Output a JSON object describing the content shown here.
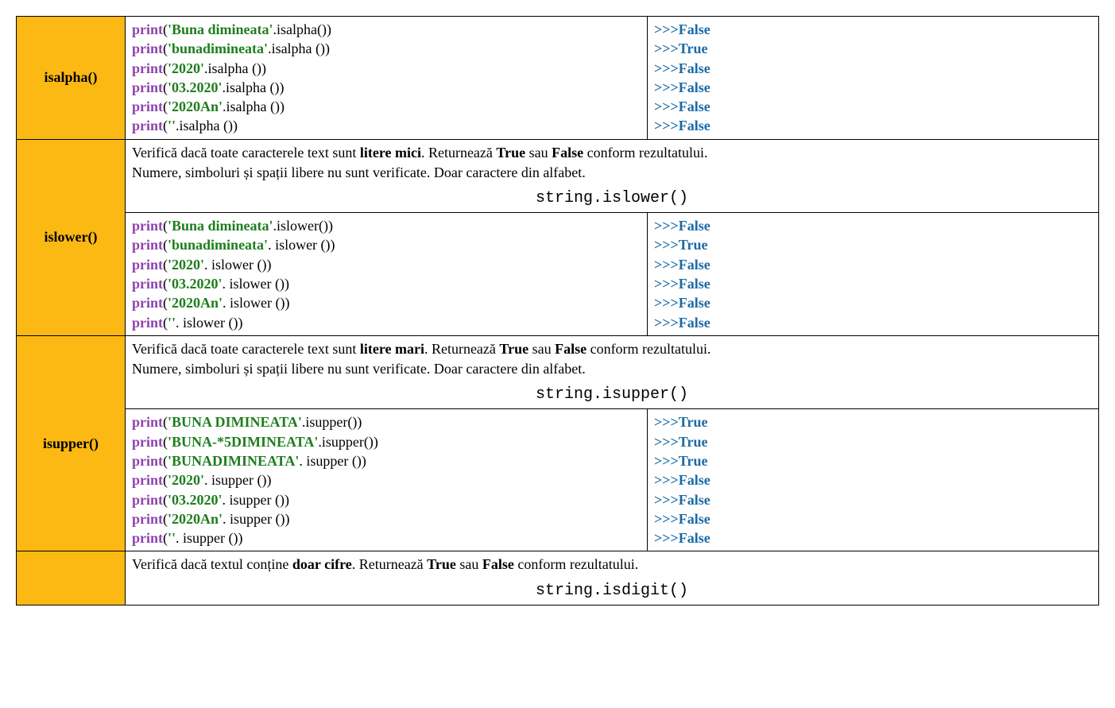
{
  "methods": {
    "isalpha": "isalpha()",
    "islower": "islower()",
    "isupper": "isupper()"
  },
  "descriptions": {
    "islower_part1": "Verifică dacă toate caracterele text sunt ",
    "islower_bold1": "litere mici",
    "islower_part2": ". Returnează ",
    "islower_bold2": "True",
    "islower_part3": " sau ",
    "islower_bold3": "False",
    "islower_part4": " conform rezultatului.",
    "islower_line2": "Numere, simboluri și spații libere nu sunt verificate. Doar caractere din alfabet.",
    "islower_syntax": "string.islower()",
    "isupper_part1": "Verifică dacă toate caracterele text sunt ",
    "isupper_bold1": "litere mari",
    "isupper_part2": ". Returnează ",
    "isupper_bold2": "True",
    "isupper_part3": " sau ",
    "isupper_bold3": "False",
    "isupper_part4": " conform rezultatului.",
    "isupper_line2": "Numere, simboluri și spații libere nu sunt verificate. Doar caractere din alfabet.",
    "isupper_syntax": "string.isupper()",
    "isdigit_part1": "Verifică dacă textul conține ",
    "isdigit_bold1": "doar cifre",
    "isdigit_part2": ". Returnează ",
    "isdigit_bold2": "True",
    "isdigit_part3": " sau ",
    "isdigit_bold3": "False",
    "isdigit_part4": " conform rezultatului.",
    "isdigit_syntax": "string.isdigit()"
  },
  "kw": {
    "print": "print",
    "gt": ">>>",
    "True": "True",
    "False": "False"
  },
  "isalpha_examples": [
    {
      "str": "'Buna dimineata'",
      "call": ".isalpha()",
      "out": "False"
    },
    {
      "str": "'bunadimineata'",
      "call": ".isalpha ()",
      "out": "True"
    },
    {
      "str": "'2020'",
      "call": ".isalpha ()",
      "out": "False"
    },
    {
      "str": "'03.2020'",
      "call": ".isalpha ()",
      "out": "False"
    },
    {
      "str": "'2020An'",
      "call": ".isalpha ()",
      "out": "False"
    },
    {
      "str": "''",
      "call": ".isalpha ()",
      "out": "False"
    }
  ],
  "islower_examples": [
    {
      "str": "'Buna dimineata'",
      "call": ".islower()",
      "out": "False"
    },
    {
      "str": "'bunadimineata'",
      "call": ". islower ()",
      "out": "True"
    },
    {
      "str": "'2020'",
      "call": ". islower ()",
      "out": "False"
    },
    {
      "str": "'03.2020'",
      "call": ". islower ()",
      "out": "False"
    },
    {
      "str": "'2020An'",
      "call": ". islower ()",
      "out": "False"
    },
    {
      "str": "''",
      "call": ". islower ()",
      "out": "False"
    }
  ],
  "isupper_examples": [
    {
      "str": "'BUNA DIMINEATA'",
      "call": ".isupper()",
      "out": "True"
    },
    {
      "str": "'BUNA-*5DIMINEATA'",
      "call": ".isupper()",
      "out": "True"
    },
    {
      "str": "'BUNADIMINEATA'",
      "call": ". isupper ()",
      "out": "True"
    },
    {
      "str": "'2020'",
      "call": ". isupper ()",
      "out": "False"
    },
    {
      "str": "'03.2020'",
      "call": ". isupper ()",
      "out": "False"
    },
    {
      "str": "'2020An'",
      "call": ". isupper ()",
      "out": "False"
    },
    {
      "str": "''",
      "call": ". isupper ()",
      "out": "False"
    }
  ]
}
